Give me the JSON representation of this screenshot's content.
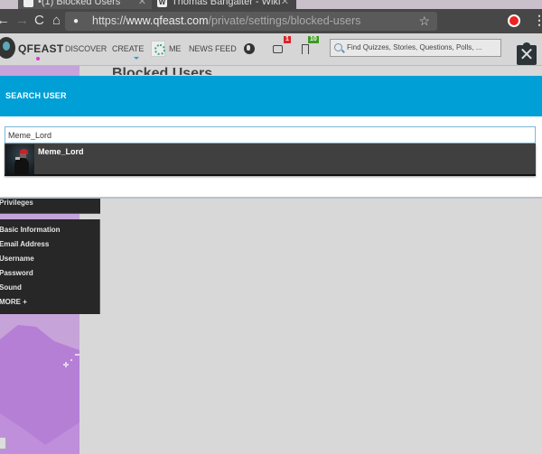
{
  "browser": {
    "tabs": [
      {
        "title": "•(1) Blocked Users",
        "favicon": "qfeast"
      },
      {
        "title": "Thomas Bangalter - Wiki",
        "favicon": "W"
      }
    ],
    "url": {
      "scheme": "https://",
      "host": "www.qfeast.com",
      "path": "/private/settings/blocked-users"
    },
    "icons": {
      "back": "←",
      "forward": "→",
      "reload": "C",
      "home": "⌂",
      "lock": "🔒",
      "star": "☆",
      "menu": "⋮",
      "tab_close": "✕"
    }
  },
  "site_header": {
    "logo": "QFEAST",
    "nav": [
      "DISCOVER",
      "CREATE",
      "ME",
      "NEWS FEED"
    ],
    "mail_badge": "1",
    "bookmark_badge": "10",
    "search_placeholder": "Find Quizzes, Stories, Questions, Polls, ...",
    "page_title": "Blocked Users"
  },
  "modal": {
    "title": "SEARCH USER",
    "close_glyph": "✕",
    "search_value": "Meme_Lord",
    "results": [
      {
        "username": "Meme_Lord"
      }
    ]
  },
  "sidebar": {
    "privileges_label": "Privileges",
    "items": [
      "Basic Information",
      "Email Address",
      "Username",
      "Password",
      "Sound",
      "MORE +"
    ]
  },
  "colors": {
    "modal_header": "#00a0d6",
    "mail_badge": "#d9252a",
    "bookmark_badge": "#3e9a22",
    "page_accent": "#c6a3d9"
  }
}
